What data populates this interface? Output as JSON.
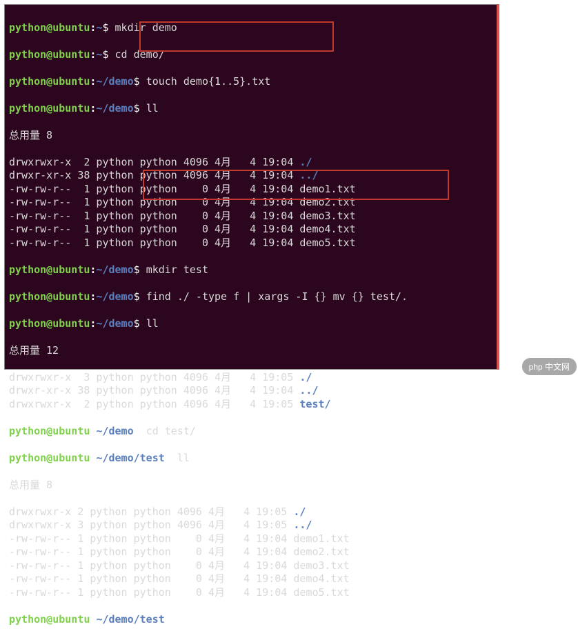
{
  "prompt": {
    "user": "python@ubuntu",
    "home_path": "~",
    "demo_path": "~/demo",
    "test_path": "~/demo/test",
    "dollar": "$"
  },
  "commands": {
    "mkdir_demo": "mkdir demo",
    "cd_demo": "cd demo/",
    "touch_demos": "touch demo{1..5}.txt",
    "ll": "ll",
    "mkdir_test": "mkdir test",
    "find_xargs": "find ./ -type f | xargs -I {} mv {} test/.",
    "cd_test": "cd test/"
  },
  "listing1": {
    "header": "总用量 8",
    "rows": [
      {
        "perm": "drwxrwxr-x",
        "n": " 2",
        "u": "python",
        "g": "python",
        "size": "4096",
        "mon": "4月",
        "day": "4",
        "time": "19:04",
        "name": "./",
        "dir": true
      },
      {
        "perm": "drwxr-xr-x",
        "n": "38",
        "u": "python",
        "g": "python",
        "size": "4096",
        "mon": "4月",
        "day": "4",
        "time": "19:04",
        "name": "../",
        "dir": true
      },
      {
        "perm": "-rw-rw-r--",
        "n": " 1",
        "u": "python",
        "g": "python",
        "size": "   0",
        "mon": "4月",
        "day": "4",
        "time": "19:04",
        "name": "demo1.txt",
        "dir": false
      },
      {
        "perm": "-rw-rw-r--",
        "n": " 1",
        "u": "python",
        "g": "python",
        "size": "   0",
        "mon": "4月",
        "day": "4",
        "time": "19:04",
        "name": "demo2.txt",
        "dir": false
      },
      {
        "perm": "-rw-rw-r--",
        "n": " 1",
        "u": "python",
        "g": "python",
        "size": "   0",
        "mon": "4月",
        "day": "4",
        "time": "19:04",
        "name": "demo3.txt",
        "dir": false
      },
      {
        "perm": "-rw-rw-r--",
        "n": " 1",
        "u": "python",
        "g": "python",
        "size": "   0",
        "mon": "4月",
        "day": "4",
        "time": "19:04",
        "name": "demo4.txt",
        "dir": false
      },
      {
        "perm": "-rw-rw-r--",
        "n": " 1",
        "u": "python",
        "g": "python",
        "size": "   0",
        "mon": "4月",
        "day": "4",
        "time": "19:04",
        "name": "demo5.txt",
        "dir": false
      }
    ]
  },
  "listing2": {
    "header": "总用量 12",
    "rows": [
      {
        "perm": "drwxrwxr-x",
        "n": " 3",
        "u": "python",
        "g": "python",
        "size": "4096",
        "mon": "4月",
        "day": "4",
        "time": "19:05",
        "name": "./",
        "dir": true
      },
      {
        "perm": "drwxr-xr-x",
        "n": "38",
        "u": "python",
        "g": "python",
        "size": "4096",
        "mon": "4月",
        "day": "4",
        "time": "19:04",
        "name": "../",
        "dir": true
      },
      {
        "perm": "drwxrwxr-x",
        "n": " 2",
        "u": "python",
        "g": "python",
        "size": "4096",
        "mon": "4月",
        "day": "4",
        "time": "19:05",
        "name": "test/",
        "dir": true
      }
    ]
  },
  "listing3": {
    "header": "总用量 8",
    "rows": [
      {
        "perm": "drwxrwxr-x",
        "n": "2",
        "u": "python",
        "g": "python",
        "size": "4096",
        "mon": "4月",
        "day": "4",
        "time": "19:05",
        "name": "./",
        "dir": true
      },
      {
        "perm": "drwxrwxr-x",
        "n": "3",
        "u": "python",
        "g": "python",
        "size": "4096",
        "mon": "4月",
        "day": "4",
        "time": "19:05",
        "name": "../",
        "dir": true
      },
      {
        "perm": "-rw-rw-r--",
        "n": "1",
        "u": "python",
        "g": "python",
        "size": "   0",
        "mon": "4月",
        "day": "4",
        "time": "19:04",
        "name": "demo1.txt",
        "dir": false
      },
      {
        "perm": "-rw-rw-r--",
        "n": "1",
        "u": "python",
        "g": "python",
        "size": "   0",
        "mon": "4月",
        "day": "4",
        "time": "19:04",
        "name": "demo2.txt",
        "dir": false
      },
      {
        "perm": "-rw-rw-r--",
        "n": "1",
        "u": "python",
        "g": "python",
        "size": "   0",
        "mon": "4月",
        "day": "4",
        "time": "19:04",
        "name": "demo3.txt",
        "dir": false
      },
      {
        "perm": "-rw-rw-r--",
        "n": "1",
        "u": "python",
        "g": "python",
        "size": "   0",
        "mon": "4月",
        "day": "4",
        "time": "19:04",
        "name": "demo4.txt",
        "dir": false
      },
      {
        "perm": "-rw-rw-r--",
        "n": "1",
        "u": "python",
        "g": "python",
        "size": "   0",
        "mon": "4月",
        "day": "4",
        "time": "19:04",
        "name": "demo5.txt",
        "dir": false
      }
    ]
  },
  "watermark": "php 中文网"
}
